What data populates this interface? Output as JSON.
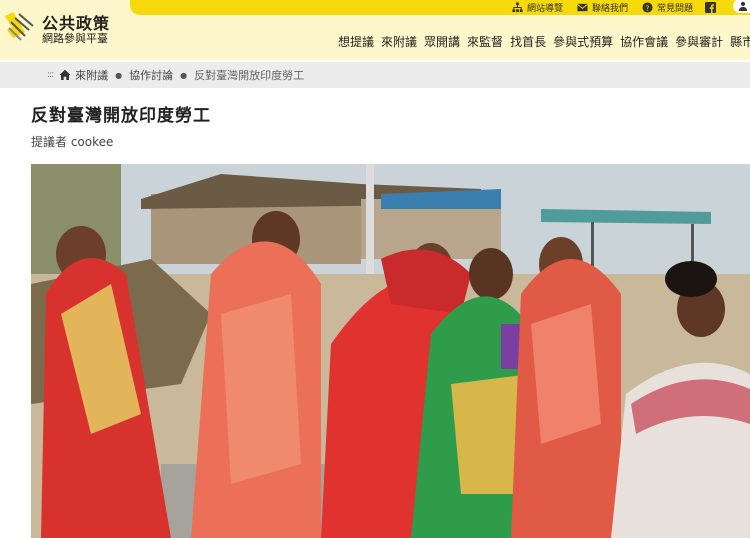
{
  "site": {
    "title": "公共政策",
    "subtitle": "網路參與平臺"
  },
  "utility": {
    "sitemap": "網站導覽",
    "contact": "聯絡我們",
    "faq": "常見問題"
  },
  "nav": {
    "items": [
      "想提議",
      "來附議",
      "眾開講",
      "來監督",
      "找首長",
      "參與式預算",
      "協作會議",
      "參與審計",
      "縣市"
    ]
  },
  "breadcrumb": {
    "dots": ":::",
    "items": [
      "來附議",
      "協作討論",
      "反對臺灣開放印度勞工"
    ]
  },
  "page": {
    "title": "反對臺灣開放印度勞工",
    "proposer": "提議者 cookee"
  },
  "colors": {
    "accent": "#f5d90a",
    "header_bg": "#fff7cc",
    "breadcrumb_bg": "#ececec"
  }
}
